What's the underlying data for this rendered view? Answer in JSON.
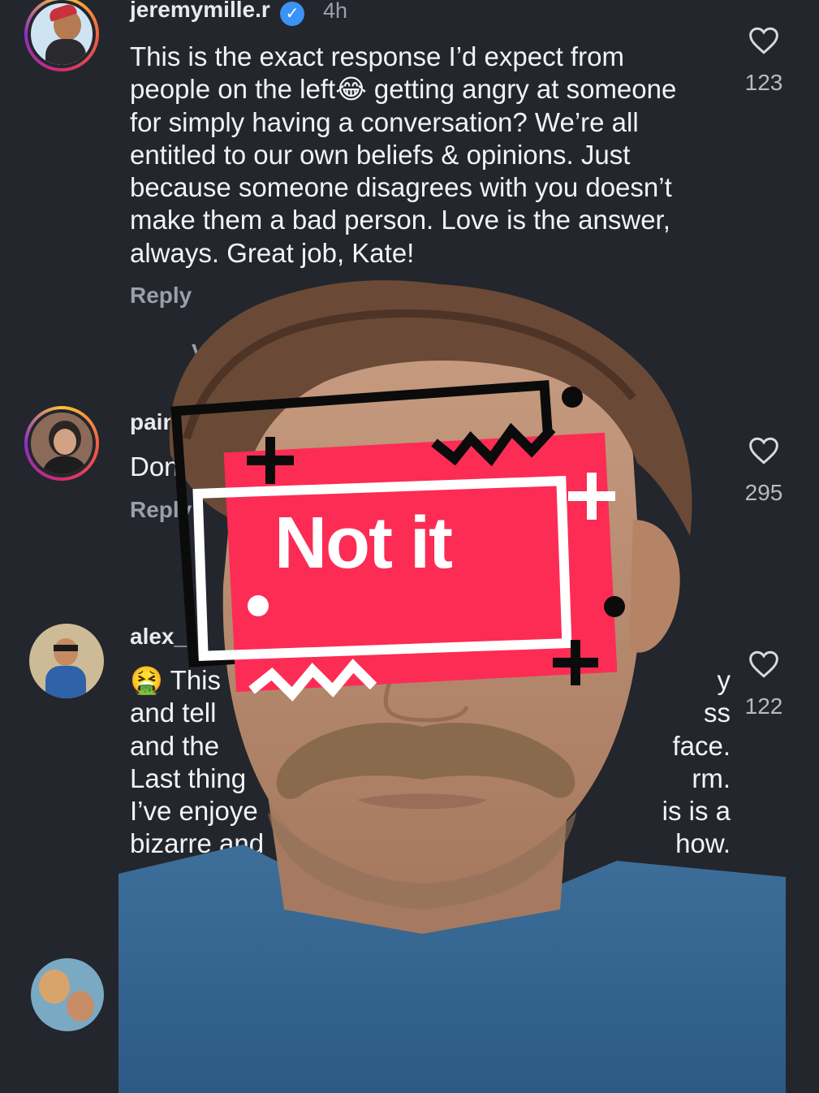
{
  "comments": [
    {
      "username": "jeremymille.r",
      "verified": true,
      "time": "4h",
      "lines": [
        "This is the exact response I’d expect from",
        "people on the left😂 getting angry at someone",
        "for simply having a conversation? We’re all",
        "entitled to our own beliefs & opinions. Just",
        "because someone disagrees with you doesn’t",
        "make them a bad person. Love is the answer,",
        "always. Great job, Kate!"
      ],
      "reply_label": "Reply",
      "view_replies": "View 3",
      "likes": "123"
    },
    {
      "username": "paint",
      "lines": [
        "Don’"
      ],
      "reply_label": "Reply",
      "likes": "295"
    },
    {
      "username": "alex_r",
      "lines": [
        "🤮 This",
        "and tell",
        "and the",
        "Last thing",
        "I’ve enjoye",
        "bizarre and"
      ],
      "right_fragments": [
        "y",
        "ss",
        "face.",
        "rm.",
        "is is a",
        "how."
      ],
      "likes": "122"
    }
  ],
  "sticker": {
    "text": "Not it",
    "color": "#fc2c55"
  },
  "icons": {
    "like": "heart-outline-icon",
    "verified": "verified-badge-icon"
  },
  "colors": {
    "background": "#23262c",
    "muted": "#9aa0a8",
    "verified": "#3b93f5"
  }
}
